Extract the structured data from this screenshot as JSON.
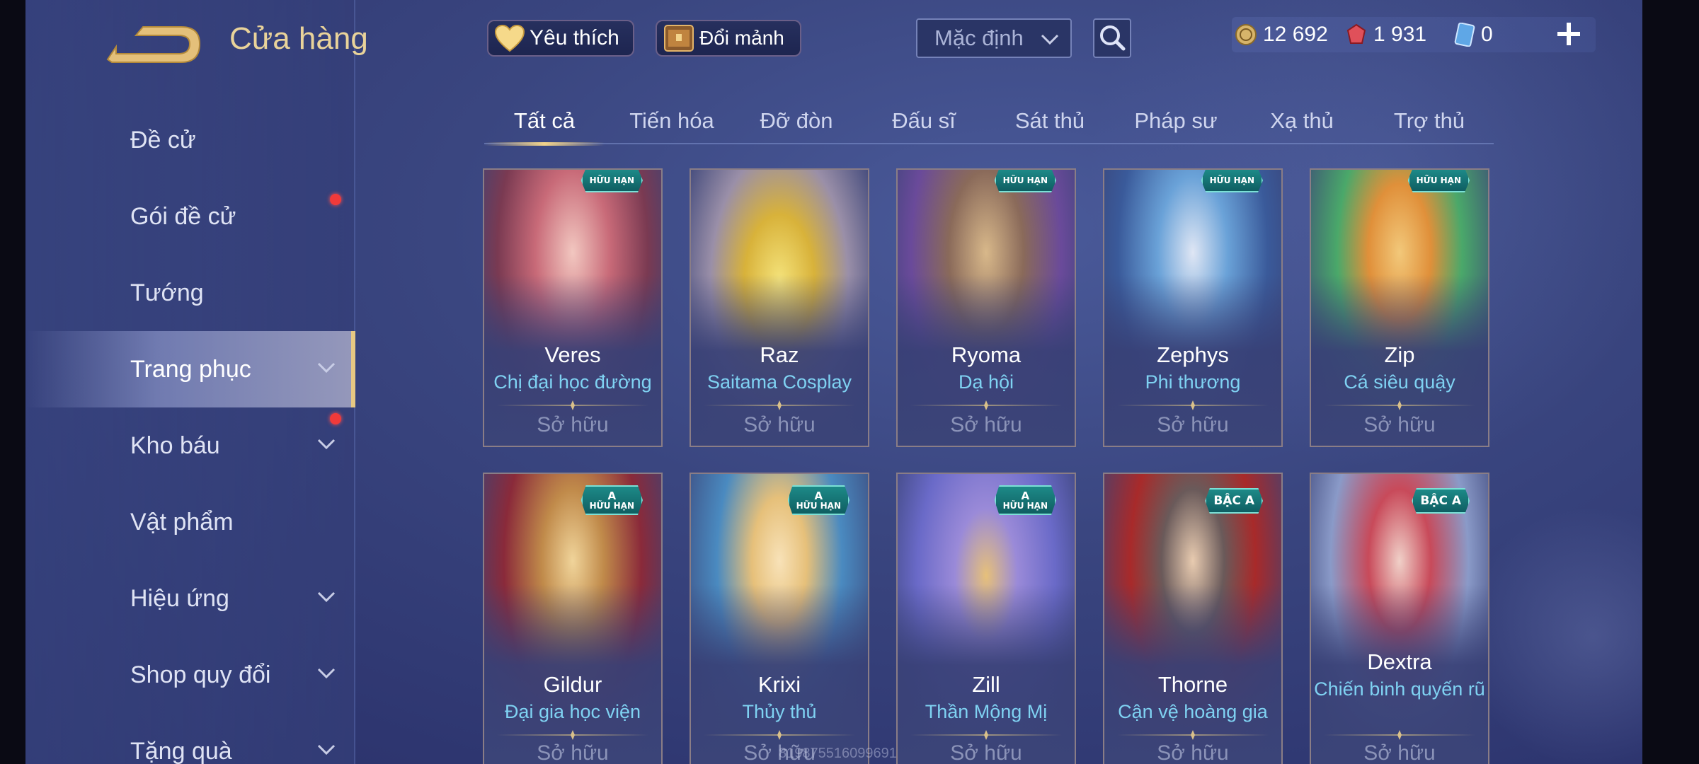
{
  "header": {
    "title": "Cửa hàng",
    "favorite_label": "Yêu thích",
    "exchange_label": "Đổi mảnh",
    "sort_value": "Mặc định"
  },
  "currency": {
    "gold": "12 692",
    "ruby": "1 931",
    "voucher": "0"
  },
  "sidebar": {
    "items": [
      {
        "label": "Đề cử"
      },
      {
        "label": "Gói đề cử"
      },
      {
        "label": "Tướng"
      },
      {
        "label": "Trang phục"
      },
      {
        "label": "Kho báu"
      },
      {
        "label": "Vật phẩm"
      },
      {
        "label": "Hiệu ứng"
      },
      {
        "label": "Shop quy đổi"
      },
      {
        "label": "Tặng quà"
      }
    ]
  },
  "tabs": [
    "Tất cả",
    "Tiến hóa",
    "Đỡ đòn",
    "Đấu sĩ",
    "Sát thủ",
    "Pháp sư",
    "Xạ thủ",
    "Trợ thủ"
  ],
  "cards": [
    {
      "hero": "Veres",
      "skin": "Chị đại học đường",
      "status": "Sở hữu",
      "tag_top": "",
      "tag_bottom": "HỮU HẠN"
    },
    {
      "hero": "Raz",
      "skin": "Saitama Cosplay",
      "status": "Sở hữu",
      "tag_top": "",
      "tag_bottom": ""
    },
    {
      "hero": "Ryoma",
      "skin": "Dạ hội",
      "status": "Sở hữu",
      "tag_top": "",
      "tag_bottom": "HỮU HẠN"
    },
    {
      "hero": "Zephys",
      "skin": "Phi thương",
      "status": "Sở hữu",
      "tag_top": "",
      "tag_bottom": "HỮU HẠN"
    },
    {
      "hero": "Zip",
      "skin": "Cá siêu quậy",
      "status": "Sở hữu",
      "tag_top": "",
      "tag_bottom": "HỮU HẠN"
    },
    {
      "hero": "Gildur",
      "skin": "Đại gia học viện",
      "status": "Sở hữu",
      "tag_top": "A",
      "tag_bottom": "HỮU HẠN"
    },
    {
      "hero": "Krixi",
      "skin": "Thủy thủ",
      "status": "Sở hữu",
      "tag_top": "A",
      "tag_bottom": "HỮU HẠN"
    },
    {
      "hero": "Zill",
      "skin": "Thần Mộng Mị",
      "status": "Sở hữu",
      "tag_top": "A",
      "tag_bottom": "HỮU HẠN"
    },
    {
      "hero": "Thorne",
      "skin": "Cận vệ hoàng gia",
      "status": "Sở hữu",
      "tag_top": "",
      "tag_bottom": "BẬC A"
    },
    {
      "hero": "Dextra",
      "skin": "Chiến binh quyến rũ",
      "status": "Sở hữu",
      "tag_top": "",
      "tag_bottom": "BẬC A"
    }
  ],
  "watermark": "819875516099691",
  "colors": {
    "accent_gold": "#e9d39a",
    "skin_name": "#7fd2f2",
    "notification_dot": "#f03a3a",
    "rarity_tag": "#1d8a88"
  },
  "icons": {
    "back": "back-arrow-icon",
    "favorite": "heart-icon",
    "exchange": "treasure-chest-icon",
    "search": "search-icon",
    "gold": "gold-coin-icon",
    "ruby": "ruby-gem-icon",
    "voucher": "voucher-card-icon",
    "plus": "plus-icon",
    "expand": "chevron-down-icon"
  }
}
